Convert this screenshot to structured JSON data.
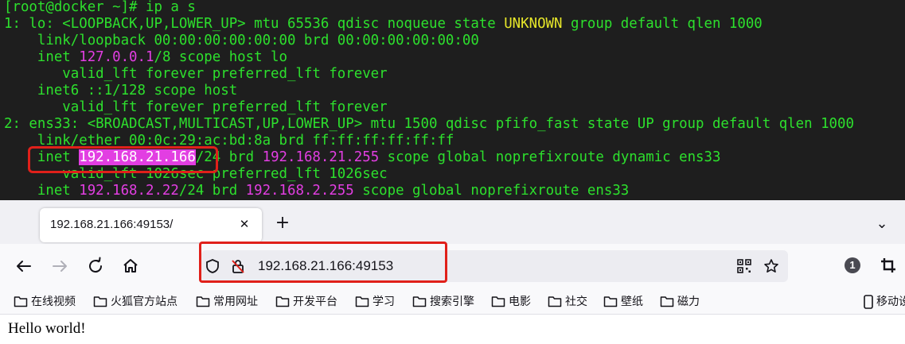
{
  "terminal": {
    "lines": [
      {
        "segments": [
          {
            "t": "[root@docker ~]# ip a s",
            "c": "g"
          }
        ]
      },
      {
        "segments": [
          {
            "t": "1: lo: <LOOPBACK,UP,LOWER_UP> mtu 65536 qdisc noqueue state ",
            "c": "g"
          },
          {
            "t": "UNKNOWN",
            "c": "y"
          },
          {
            "t": " group default qlen 1000",
            "c": "g"
          }
        ]
      },
      {
        "segments": [
          {
            "t": "    link/loopback 00:00:00:00:00:00 brd 00:00:00:00:00:00",
            "c": "g"
          }
        ]
      },
      {
        "segments": [
          {
            "t": "    inet ",
            "c": "g"
          },
          {
            "t": "127.0.0.1",
            "c": "m"
          },
          {
            "t": "/8 scope host lo",
            "c": "g"
          }
        ]
      },
      {
        "segments": [
          {
            "t": "       valid_lft forever preferred_lft forever",
            "c": "g"
          }
        ]
      },
      {
        "segments": [
          {
            "t": "    inet6 ::1/128 scope host",
            "c": "g"
          }
        ]
      },
      {
        "segments": [
          {
            "t": "       valid_lft forever preferred_lft forever",
            "c": "g"
          }
        ]
      },
      {
        "segments": [
          {
            "t": "2: ens33: <BROADCAST,MULTICAST,UP,LOWER_UP> mtu 1500 qdisc pfifo_fast state UP group default qlen 1000",
            "c": "g"
          }
        ]
      },
      {
        "segments": [
          {
            "t": "    link/ether 00:0c:29:ac:bd:8a brd ff:ff:ff:ff:ff:ff",
            "c": "g"
          }
        ]
      },
      {
        "segments": [
          {
            "t": "    inet ",
            "c": "g"
          },
          {
            "t": "192.168.21.166",
            "c": "sel"
          },
          {
            "t": "/24 brd ",
            "c": "g"
          },
          {
            "t": "192.168.21.255",
            "c": "m"
          },
          {
            "t": " scope global noprefixroute dynamic ens33",
            "c": "g"
          }
        ]
      },
      {
        "segments": [
          {
            "t": "       valid_lft 1026sec preferred_lft 1026sec",
            "c": "g"
          }
        ]
      },
      {
        "segments": [
          {
            "t": "    inet ",
            "c": "g"
          },
          {
            "t": "192.168.2.22",
            "c": "m"
          },
          {
            "t": "/24 brd ",
            "c": "g"
          },
          {
            "t": "192.168.2.255",
            "c": "m"
          },
          {
            "t": " scope global noprefixroute ens33",
            "c": "g"
          }
        ]
      }
    ]
  },
  "browser": {
    "tab_title": "192.168.21.166:49153/",
    "tab_close": "✕",
    "new_tab": "+",
    "menu_chevron": "⌄",
    "url": "192.168.21.166:49153",
    "badge": "1",
    "bookmarks": [
      "在线视频",
      "火狐官方站点",
      "常用网址",
      "开发平台",
      "学习",
      "搜索引擎",
      "电影",
      "社交",
      "壁纸",
      "磁力"
    ],
    "mobile_bookmarks": "移动设",
    "page_text": "Hello world!"
  },
  "colors": {
    "terminal_bg": "#1e1e1e",
    "term_green": "#2de02d",
    "term_yellow": "#e8e82a",
    "term_magenta": "#e23ee2",
    "highlight_red": "#e0201a"
  }
}
